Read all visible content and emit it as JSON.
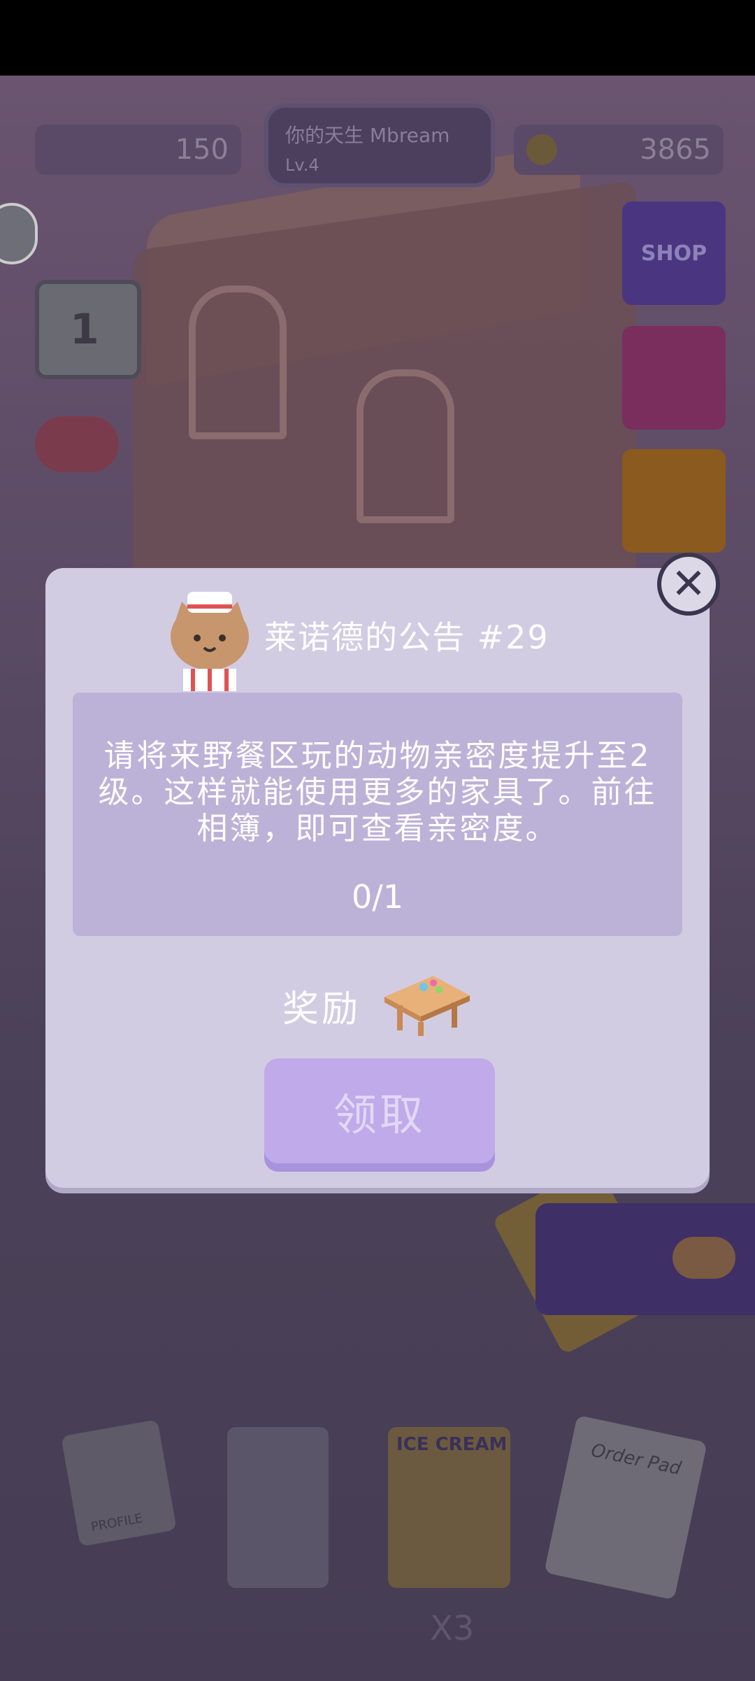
{
  "hud": {
    "left_value": "150",
    "player_name": "你的天生 Mbream",
    "player_level": "Lv.4",
    "coins": "3865"
  },
  "sidebar": {
    "calendar_day": "1",
    "shop_label": "SHOP"
  },
  "bottom_items": {
    "profile_label": "PROFILE",
    "icecream_label": "ICE CREAM",
    "order_label": "Order Pad",
    "multiplier": "X3"
  },
  "dialog": {
    "title": "莱诺德的公告 #29",
    "description": "请将来野餐区玩的动物亲密度提升至2级。这样就能使用更多的家具了。前往相簿，即可查看亲密度。",
    "progress": "0/1",
    "reward_label": "奖励",
    "claim_button": "领取",
    "close_icon": "close-icon"
  },
  "colors": {
    "dialog_bg": "#d2cce2",
    "panel_bg": "#bcb1d6",
    "claim_button_bg": "#c0aaea",
    "overlay_scene": "#4a3f5a"
  }
}
